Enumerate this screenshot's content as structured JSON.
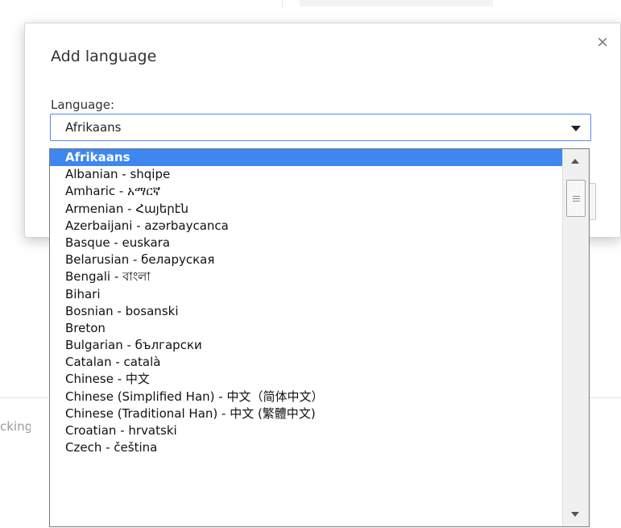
{
  "background": {
    "partial_text": "cking"
  },
  "dialog": {
    "title": "Add language",
    "close_glyph": "×",
    "language_label": "Language:",
    "select": {
      "value": "Afrikaans",
      "arrow_icon": "dropdown-arrow"
    }
  },
  "dropdown": {
    "selected_index": 0,
    "options": [
      "Afrikaans",
      "Albanian - shqipe",
      "Amharic - አማርኛ",
      "Armenian - Հայերէն",
      "Azerbaijani - azərbaycanca",
      "Basque - euskara",
      "Belarusian - беларуская",
      "Bengali - বাংলা",
      "Bihari",
      "Bosnian - bosanski",
      "Breton",
      "Bulgarian - български",
      "Catalan - català",
      "Chinese - 中文",
      "Chinese (Simplified Han) - 中文（简体中文）",
      "Chinese (Traditional Han) - 中文 (繁體中文)",
      "Croatian - hrvatski",
      "Czech - čeština"
    ]
  },
  "colors": {
    "selection_bg": "#3e86f0",
    "focus_border": "#4c8bf5"
  }
}
